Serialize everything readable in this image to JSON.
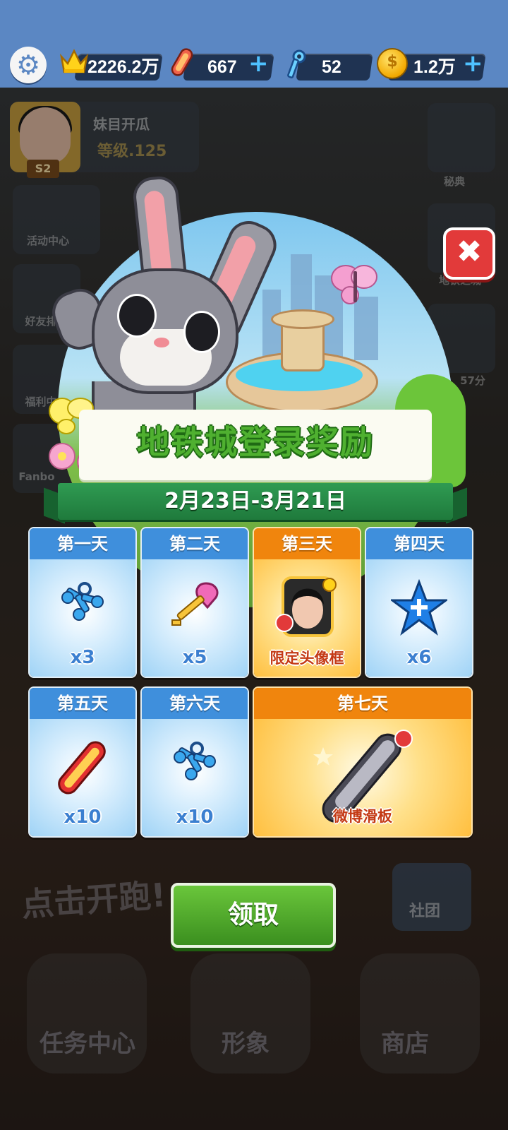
{
  "top_bar": {
    "trophies": "2226.2万",
    "hoverboards": "667",
    "keys": "52",
    "coins": "1.2万",
    "plus_symbol": "+"
  },
  "background_ui": {
    "player_name": "妹目开瓜",
    "player_level": "等级.125",
    "player_badge": "S2",
    "left_menu": [
      "活动中心",
      "好友排",
      "福利中",
      "Fanbo"
    ],
    "right_menu": [
      "秘典",
      "地铁之城",
      "57分"
    ],
    "run_prompt": "点击开跑!",
    "club_label": "社团",
    "bottom_nav": [
      "任务中心",
      "形象",
      "商店"
    ]
  },
  "dialog": {
    "close_symbol": "✖",
    "title": "地铁城登录奖励",
    "date_range": "2月23日-3月21日",
    "rewards": [
      {
        "day": "第一天",
        "label": "x3",
        "item_icon": "keys-bundle-icon",
        "style": "blue"
      },
      {
        "day": "第二天",
        "label": "x5",
        "item_icon": "golden-key-icon",
        "style": "blue"
      },
      {
        "day": "第三天",
        "label": "限定头像框",
        "item_icon": "avatar-frame-icon",
        "style": "orange"
      },
      {
        "day": "第四天",
        "label": "x6",
        "item_icon": "score-booster-star-icon",
        "style": "blue"
      },
      {
        "day": "第五天",
        "label": "x10",
        "item_icon": "hoverboard-icon",
        "style": "blue"
      },
      {
        "day": "第六天",
        "label": "x10",
        "item_icon": "keys-bundle-icon",
        "style": "blue"
      },
      {
        "day": "第七天",
        "label": "微博滑板",
        "item_icon": "weibo-hoverboard-icon",
        "style": "orange"
      }
    ],
    "claim_button": "领取"
  },
  "colors": {
    "top_bar_bg": "#5b87c3",
    "card_blue": "#3f8fdc",
    "card_orange": "#f0850d",
    "claim_green": "#4fa82c",
    "title_green": "#4fb030"
  }
}
